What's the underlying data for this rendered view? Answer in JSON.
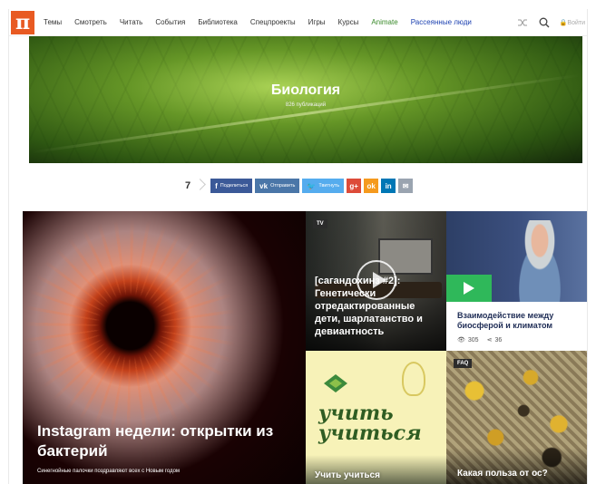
{
  "nav": {
    "logo": "π",
    "items": [
      "Темы",
      "Смотреть",
      "Читать",
      "События",
      "Библиотека",
      "Спецпроекты",
      "Игры",
      "Курсы",
      "Animate",
      "Рассеянные люди"
    ],
    "login": "Войти"
  },
  "hero": {
    "title": "Биология",
    "count": "826 публикаций"
  },
  "share": {
    "count": "7",
    "facebook": "Поделиться",
    "vk": "Отправить",
    "twitter": "Твитнуть",
    "colors": {
      "facebook": "#3b5998",
      "vk": "#4a76a8",
      "twitter": "#55acee",
      "google": "#dd4b39",
      "ok": "#f59a1e",
      "linkedin": "#0077b5",
      "email": "#9aa4b0"
    }
  },
  "cards": {
    "big": {
      "title": "Instagram недели: открытки из бактерий",
      "subtitle": "Синегнойные палочки поздравляют всех с Новым годом"
    },
    "tv": {
      "badge": "TV",
      "title": "[сагандохинз #2]: Генетически отредактированные дети, шарлатанство и девиантность"
    },
    "climate": {
      "title": "Взаимодействие между биосферой и климатом",
      "views": "305",
      "shares": "36"
    },
    "learn": {
      "script": "учить учиться",
      "title": "Учить учиться"
    },
    "wasps": {
      "badge": "FAQ",
      "title": "Какая польза от ос?"
    }
  }
}
